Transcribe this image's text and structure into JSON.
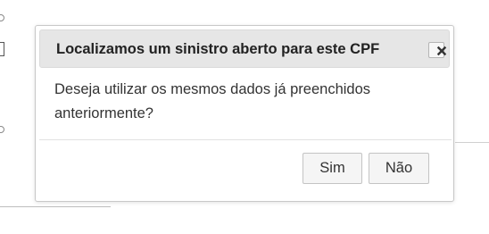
{
  "dialog": {
    "title": "Localizamos um sinistro aberto para este CPF",
    "message": "Deseja utilizar os mesmos dados já preenchidos anteriormente?",
    "close_icon": "close-icon",
    "buttons": {
      "yes_label": "Sim",
      "no_label": "Não"
    }
  },
  "colors": {
    "header_background": "#e6e6e6",
    "button_background": "#f5f5f5",
    "text": "#333333"
  }
}
